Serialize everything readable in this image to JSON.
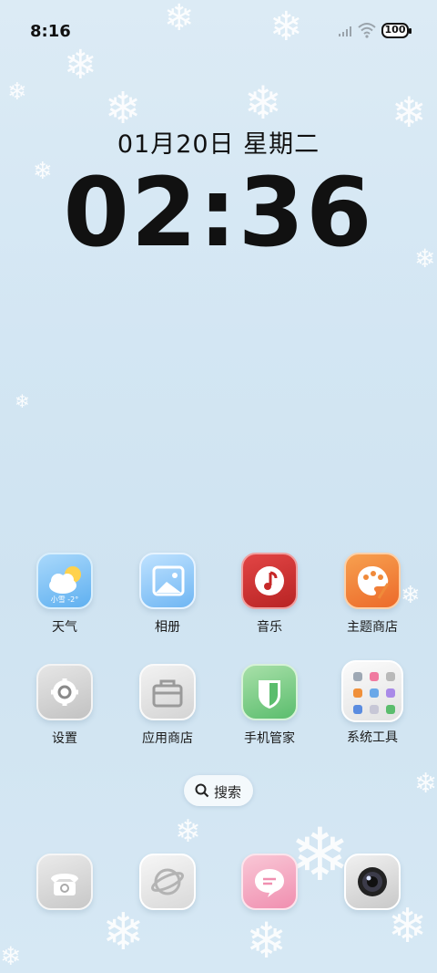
{
  "status_bar": {
    "time": "8:16",
    "battery": "100"
  },
  "lockclock": {
    "date": "01月20日 星期二",
    "time": "02:36"
  },
  "apps_row1": [
    {
      "label": "天气",
      "icon": "weather-icon",
      "badge": "小雪 -2°"
    },
    {
      "label": "相册",
      "icon": "gallery-icon"
    },
    {
      "label": "音乐",
      "icon": "music-icon"
    },
    {
      "label": "主题商店",
      "icon": "theme-store-icon"
    }
  ],
  "apps_row2": [
    {
      "label": "设置",
      "icon": "settings-icon"
    },
    {
      "label": "应用商店",
      "icon": "app-store-icon"
    },
    {
      "label": "手机管家",
      "icon": "phone-manager-icon"
    },
    {
      "label": "系统工具",
      "icon": "system-tools-folder-icon"
    }
  ],
  "search": {
    "label": "搜索"
  },
  "dock": [
    {
      "icon": "phone-icon"
    },
    {
      "icon": "browser-icon"
    },
    {
      "icon": "messages-icon"
    },
    {
      "icon": "camera-icon"
    }
  ],
  "colors": {
    "background": "#d3e6f3",
    "music": "#d13535",
    "theme": "#f08a3a",
    "security": "#5bbd6d"
  }
}
